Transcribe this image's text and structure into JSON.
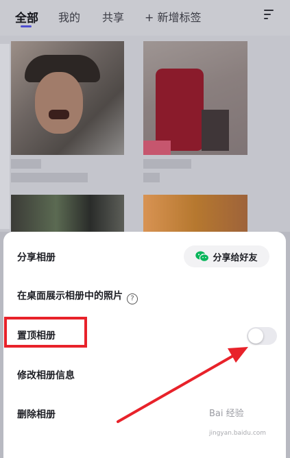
{
  "tabs": [
    {
      "label": "全部",
      "active": true
    },
    {
      "label": "我的",
      "active": false
    },
    {
      "label": "共享",
      "active": false
    },
    {
      "label": "+ 新增标签",
      "active": false
    }
  ],
  "sheet": {
    "share_album": "分享相册",
    "share_to_friends": "分享给好友",
    "show_on_desktop": "在桌面展示相册中的照片",
    "help_glyph": "?",
    "pin_album": "置顶相册",
    "pin_toggle_on": false,
    "edit_album": "修改相册信息",
    "delete_album": "删除相册"
  },
  "watermark": {
    "brand": "Bai 经验",
    "url": "jingyan.baidu.com"
  },
  "colors": {
    "accent": "#4f4fd1",
    "annotation_red": "#e8222a",
    "wechat_green": "#08b55a"
  }
}
